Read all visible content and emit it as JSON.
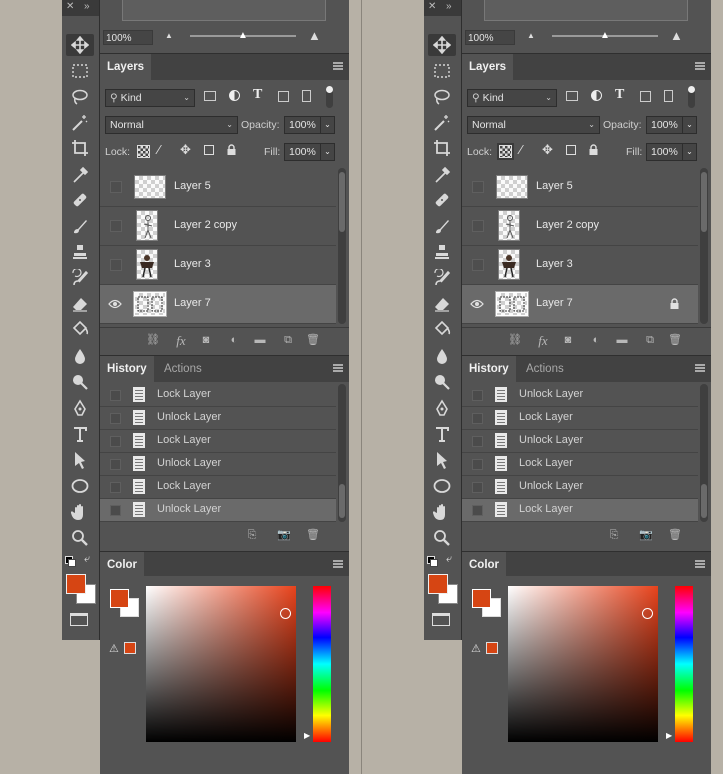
{
  "colors": {
    "accent": "#d64513",
    "panel": "#535353",
    "panel_dark": "#424242",
    "selected_row": "#6a6a6a"
  },
  "panes": [
    {
      "zoom": "100%",
      "layers": {
        "tab": "Layers",
        "filter": "Kind",
        "blend": "Normal",
        "opacity_label": "Opacity:",
        "opacity": "100%",
        "lock_label": "Lock:",
        "fill_label": "Fill:",
        "fill": "100%",
        "items": [
          {
            "name": "Layer 5",
            "visible": false,
            "selected": false,
            "locked": false
          },
          {
            "name": "Layer 2 copy",
            "visible": false,
            "selected": false,
            "locked": false
          },
          {
            "name": "Layer 3",
            "visible": false,
            "selected": false,
            "locked": false
          },
          {
            "name": "Layer 7",
            "visible": true,
            "selected": true,
            "locked": false
          }
        ]
      },
      "history": {
        "tabs": [
          "History",
          "Actions"
        ],
        "items": [
          "Lock Layer",
          "Unlock Layer",
          "Lock Layer",
          "Unlock Layer",
          "Lock Layer",
          "Unlock Layer"
        ],
        "selected_index": 5
      },
      "color": {
        "tab": "Color"
      }
    },
    {
      "zoom": "100%",
      "layers": {
        "tab": "Layers",
        "filter": "Kind",
        "blend": "Normal",
        "opacity_label": "Opacity:",
        "opacity": "100%",
        "lock_label": "Lock:",
        "fill_label": "Fill:",
        "fill": "100%",
        "items": [
          {
            "name": "Layer 5",
            "visible": false,
            "selected": false,
            "locked": false
          },
          {
            "name": "Layer 2 copy",
            "visible": false,
            "selected": false,
            "locked": false
          },
          {
            "name": "Layer 3",
            "visible": false,
            "selected": false,
            "locked": false
          },
          {
            "name": "Layer 7",
            "visible": true,
            "selected": true,
            "locked": true
          }
        ]
      },
      "history": {
        "tabs": [
          "History",
          "Actions"
        ],
        "items": [
          "Unlock Layer",
          "Lock Layer",
          "Unlock Layer",
          "Lock Layer",
          "Unlock Layer",
          "Lock Layer"
        ],
        "selected_index": 5
      },
      "color": {
        "tab": "Color"
      }
    }
  ],
  "tools": [
    "move-tool-icon",
    "marquee-tool-icon",
    "lasso-tool-icon",
    "magic-wand-icon",
    "crop-tool-icon",
    "eyedropper-icon",
    "healing-brush-icon",
    "brush-tool-icon",
    "clone-stamp-icon",
    "history-brush-icon",
    "eraser-icon",
    "paint-bucket-icon",
    "blur-tool-icon",
    "dodge-tool-icon",
    "pen-tool-icon",
    "type-tool-icon",
    "path-selection-icon",
    "ellipse-tool-icon",
    "hand-tool-icon",
    "zoom-tool-icon"
  ]
}
